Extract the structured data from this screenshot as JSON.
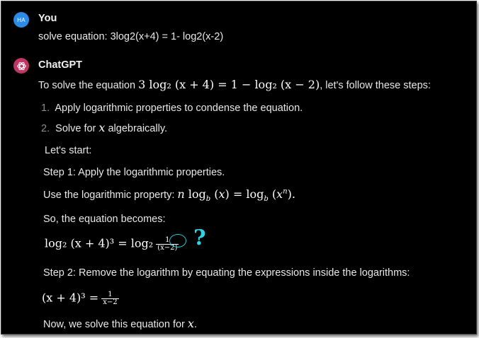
{
  "user": {
    "avatar_initials": "HA",
    "name": "You",
    "message": "solve equation: 3log2(x+4) = 1- log2(x-2)"
  },
  "assistant": {
    "name": "ChatGPT",
    "intro_pre": "To solve the equation ",
    "intro_math": "3 log₂ (x + 4) = 1 − log₂ (x − 2)",
    "intro_post": ", let's follow these steps:",
    "steps": [
      {
        "num": "1.",
        "text": "Apply logarithmic properties to condense the equation."
      },
      {
        "num": "2.",
        "text_pre": "Solve for ",
        "var": "x",
        "text_post": " algebraically."
      }
    ],
    "lets_start": "Let's start:",
    "step1_title": "Step 1: Apply the logarithmic properties.",
    "step1_text": "Use the logarithmic property: ",
    "step1_math": "n log_b (x) = log_b (x^n).",
    "becomes": "So, the equation becomes:",
    "eq1": {
      "lhs": "log₂ (x + 4)³ = log₂",
      "num": "1",
      "den": "(x−2)"
    },
    "step2_title": "Step 2: Remove the logarithm by equating the expressions inside the logarithms:",
    "eq2": {
      "lhs": "(x + 4)³ =",
      "num": "1",
      "den": "x−2"
    },
    "final_pre": "Now, we solve this equation for ",
    "final_var": "x",
    "final_post": "."
  },
  "annotation": {
    "mark": "?",
    "color": "#2fd3e2"
  },
  "colors": {
    "background": "#000000",
    "user_avatar": "#2c8be6",
    "bot_avatar": "#c23666"
  }
}
